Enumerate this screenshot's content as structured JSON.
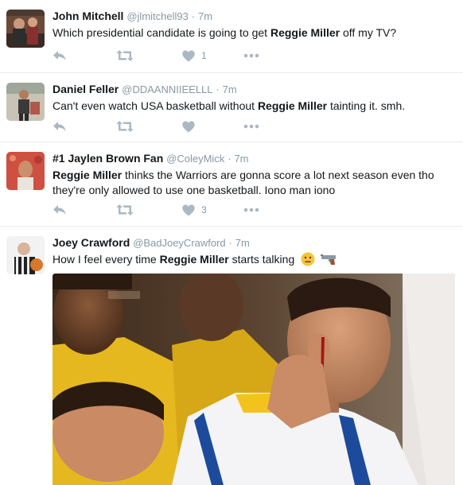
{
  "tweets": [
    {
      "name": "John Mitchell",
      "handle": "@jlmitchell93",
      "sep": "·",
      "time": "7m",
      "text_pre": "Which presidential candidate is going to get ",
      "text_bold": "Reggie Miller",
      "text_post": " off my TV?",
      "likes": "1"
    },
    {
      "name": "Daniel Feller",
      "handle": "@DDAANNIIEELLL",
      "sep": "·",
      "time": "7m",
      "text_pre": "Can't even watch USA basketball without ",
      "text_bold": "Reggie Miller",
      "text_post": " tainting it. smh.",
      "likes": ""
    },
    {
      "name": "#1 Jaylen Brown Fan",
      "handle": "@ColeyMick",
      "sep": "·",
      "time": "7m",
      "text_pre": "",
      "text_bold": "Reggie Miller",
      "text_post": " thinks the Warriors are gonna score a lot next season even tho they're only allowed to use one basketball. Iono man iono",
      "likes": "3"
    },
    {
      "name": "Joey Crawford",
      "handle": "@BadJoeyCrawford",
      "sep": "·",
      "time": "7m",
      "text_pre": "How I feel every time ",
      "text_bold": "Reggie Miller",
      "text_post": " starts talking",
      "emoji": [
        "neutral-face-emoji",
        "pistol-emoji"
      ]
    }
  ],
  "colors": {
    "name": "#14171a",
    "meta": "#8899a6",
    "icon": "#aab8c2",
    "divider": "#e6ecf0"
  },
  "icons": [
    "reply-icon",
    "retweet-icon",
    "heart-icon",
    "more-icon"
  ]
}
